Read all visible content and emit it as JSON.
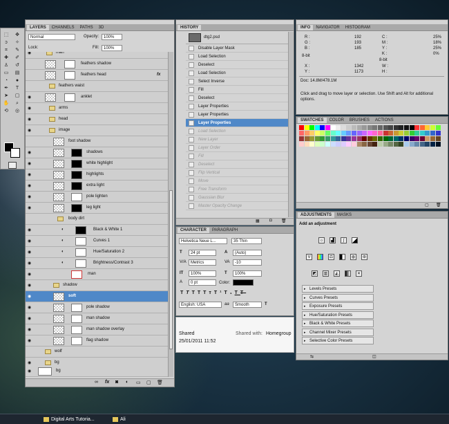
{
  "layers_panel": {
    "tabs": [
      "LAYERS",
      "CHANNELS",
      "PATHS",
      "3D"
    ],
    "blend_mode": "Normal",
    "opacity_label": "Opacity:",
    "opacity_value": "100%",
    "lock_label": "Lock:",
    "fill_label": "Fill:",
    "fill_value": "100%",
    "layers": [
      {
        "name": "man",
        "type": "folder"
      },
      {
        "name": "feathers shadow",
        "type": "layer"
      },
      {
        "name": "feathers head",
        "type": "layer",
        "fx": "fx"
      },
      {
        "name": "feathers waist",
        "type": "folder"
      },
      {
        "name": "anklet",
        "type": "layer"
      },
      {
        "name": "arms",
        "type": "folder"
      },
      {
        "name": "head",
        "type": "folder"
      },
      {
        "name": "image",
        "type": "folder"
      },
      {
        "name": "foot shadow",
        "type": "layer"
      },
      {
        "name": "shadows",
        "type": "layer"
      },
      {
        "name": "white highlight",
        "type": "layer"
      },
      {
        "name": "highlights",
        "type": "layer"
      },
      {
        "name": "extra light",
        "type": "layer"
      },
      {
        "name": "pole lighten",
        "type": "layer"
      },
      {
        "name": "leg light",
        "type": "layer"
      },
      {
        "name": "body dirt",
        "type": "folder"
      },
      {
        "name": "Black & White 1",
        "type": "adjustment"
      },
      {
        "name": "Curves 1",
        "type": "adjustment"
      },
      {
        "name": "Hue/Saturation 2",
        "type": "adjustment"
      },
      {
        "name": "Brightness/Contrast 3",
        "type": "adjustment"
      },
      {
        "name": "man",
        "type": "layer"
      },
      {
        "name": "shadow",
        "type": "folder"
      },
      {
        "name": "soft",
        "type": "layer",
        "selected": true
      },
      {
        "name": "pole shadow",
        "type": "layer"
      },
      {
        "name": "man shadow",
        "type": "layer"
      },
      {
        "name": "man shadow overlay",
        "type": "layer"
      },
      {
        "name": "flag shadow",
        "type": "layer"
      },
      {
        "name": "wolf",
        "type": "folder"
      },
      {
        "name": "bg",
        "type": "folder"
      },
      {
        "name": "bg",
        "type": "layer"
      }
    ],
    "footer_icons": [
      "fx"
    ]
  },
  "history_panel": {
    "tab": "HISTORY",
    "snapshot": "dtg2.psd",
    "items": [
      {
        "label": "Disable Layer Mask"
      },
      {
        "label": "Load Selection"
      },
      {
        "label": "Deselect"
      },
      {
        "label": "Load Selection"
      },
      {
        "label": "Select Inverse"
      },
      {
        "label": "Fill"
      },
      {
        "label": "Deselect"
      },
      {
        "label": "Layer Properties"
      },
      {
        "label": "Layer Properties"
      },
      {
        "label": "Layer Properties",
        "selected": true
      },
      {
        "label": "Load Selection",
        "dim": true
      },
      {
        "label": "New Layer",
        "dim": true
      },
      {
        "label": "Layer Order",
        "dim": true
      },
      {
        "label": "Fill",
        "dim": true
      },
      {
        "label": "Deselect",
        "dim": true
      },
      {
        "label": "Flip Vertical",
        "dim": true
      },
      {
        "label": "Move",
        "dim": true
      },
      {
        "label": "Free Transform",
        "dim": true
      },
      {
        "label": "Gaussian Blur",
        "dim": true
      },
      {
        "label": "Master Opacity Change",
        "dim": true
      }
    ]
  },
  "character_panel": {
    "tabs": [
      "CHARACTER",
      "PARAGRAPH"
    ],
    "font_family": "Helvetica Neue L...",
    "font_style": "35 Thin",
    "font_size": "24 pt",
    "leading": "(Auto)",
    "kerning": "Metrics",
    "tracking": "-10",
    "vscale": "100%",
    "hscale": "100%",
    "baseline": "0 pt",
    "color_label": "Color:",
    "language": "English: USA",
    "aa_label": "aa",
    "antialias": "Smooth",
    "aa_glyph": "T"
  },
  "shared_bar": {
    "status": "Shared",
    "date": "25/01/2011 11:52",
    "shared_with_label": "Shared with:",
    "shared_with": "Homegroup"
  },
  "info_panel": {
    "tabs": [
      "INFO",
      "NAVIGATOR",
      "HISTOGRAM"
    ],
    "rgb": {
      "R": "192",
      "G": "193",
      "B": "185"
    },
    "cmyk": {
      "C": "25%",
      "M": "18%",
      "Y": "25%",
      "K": "0%"
    },
    "bit_left": "8-bit",
    "bit_right": "8-bit",
    "x": "1342",
    "y": "1173",
    "doc": "Doc: 14.8M/478.1M",
    "hint": "Click and drag to move layer or selection.  Use Shift and Alt for additional options."
  },
  "swatches_panel": {
    "tabs": [
      "SWATCHES",
      "COLOR",
      "BRUSHES",
      "ACTIONS"
    ]
  },
  "adjustments_panel": {
    "tabs": [
      "ADJUSTMENTS",
      "MASKS"
    ],
    "heading": "Add an adjustment",
    "presets": [
      "Levels Presets",
      "Curves Presets",
      "Exposure Presets",
      "Hue/Saturation Presets",
      "Black & White Presets",
      "Channel Mixer Presets",
      "Selective Color Presets"
    ]
  },
  "taskbar": {
    "item1": "Digital Arts Tutoria...",
    "item2": "Ali"
  },
  "colors": {
    "selection": "#4f88c8",
    "panel": "#d4d4d4"
  }
}
